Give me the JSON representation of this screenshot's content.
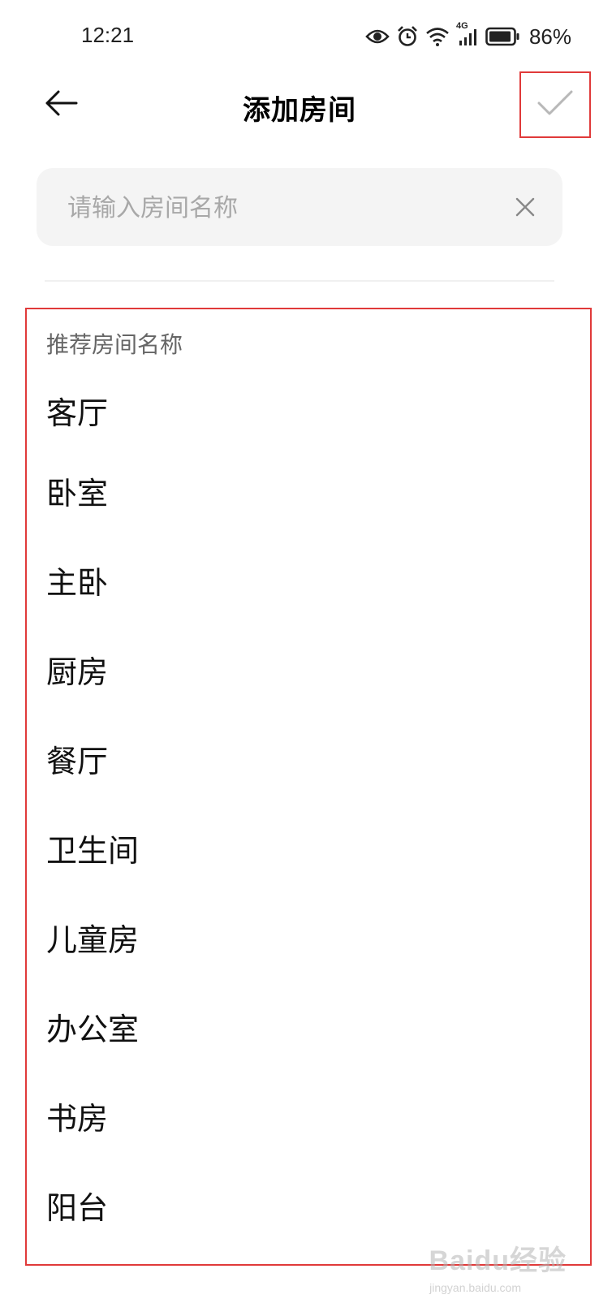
{
  "status_bar": {
    "time": "12:21",
    "network": "4G",
    "battery_percent": "86%"
  },
  "header": {
    "title": "添加房间",
    "back_icon": "arrow-left-icon",
    "confirm_icon": "checkmark-icon"
  },
  "name_input": {
    "placeholder": "请输入房间名称",
    "value": "",
    "clear_icon": "close-icon"
  },
  "suggestions": {
    "heading": "推荐房间名称",
    "items": [
      {
        "label": "客厅"
      },
      {
        "label": "卧室"
      },
      {
        "label": "主卧"
      },
      {
        "label": "厨房"
      },
      {
        "label": "餐厅"
      },
      {
        "label": "卫生间"
      },
      {
        "label": "儿童房"
      },
      {
        "label": "办公室"
      },
      {
        "label": "书房"
      },
      {
        "label": "阳台"
      }
    ]
  },
  "watermark": {
    "brand": "Baidu经验",
    "url": "jingyan.baidu.com"
  },
  "colors": {
    "highlight_border": "#e03a3a",
    "input_bg": "#f4f4f4",
    "placeholder": "#a8a8a8",
    "heading": "#666666",
    "confirm_check": "#b8b8b8"
  }
}
